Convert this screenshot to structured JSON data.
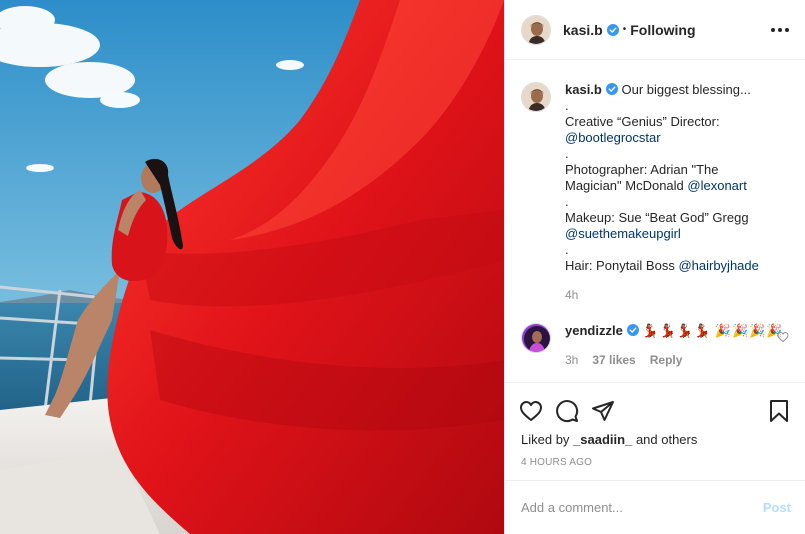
{
  "header": {
    "username": "kasi.b",
    "separator": "•",
    "follow_status": "Following"
  },
  "caption": {
    "username": "kasi.b",
    "lines": [
      "Our biggest blessing...",
      ".",
      "Creative “Genius” Director:",
      "@bootlegrocstar",
      ".",
      "Photographer: Adrian \"The",
      "Magician\" McDonald",
      "@lexonart",
      ".",
      "Makeup: Sue “Beat God” Gregg",
      "@suethemakeupgirl",
      ".",
      "Hair: Ponytail Boss",
      "@hairbyjhade"
    ],
    "time": "4h"
  },
  "comment": {
    "username": "yendizzle",
    "text_line1": "💃🏽💃🏽💃🏽💃🏽",
    "text_line2": "🎉🎉🎉🎉",
    "time": "3h",
    "likes": "37 likes",
    "reply": "Reply"
  },
  "likes": {
    "prefix": "Liked by",
    "user": "_saadiin_",
    "suffix": "and others"
  },
  "time_ago": "4 HOURS AGO",
  "add_comment": {
    "placeholder": "Add a comment...",
    "post_label": "Post"
  },
  "icons": {
    "verified": "verified-badge-icon",
    "more": "more-options-icon",
    "like": "heart-icon",
    "comment": "comment-bubble-icon",
    "share": "paper-plane-icon",
    "save": "bookmark-icon"
  },
  "colors": {
    "verified_blue": "#3897f0",
    "dress_red": "#e0141b",
    "sky": "#3d9bd0",
    "sea": "#2f7ea6",
    "post_button": "#b2dffc"
  }
}
